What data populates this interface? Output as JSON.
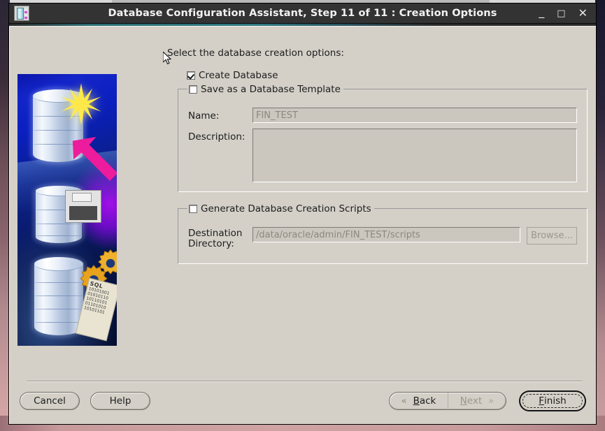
{
  "window": {
    "title": "Database Configuration Assistant, Step 11 of 11 : Creation Options",
    "icon_name": "database-app-icon",
    "minimize_label": "_",
    "maximize_label": "□",
    "close_label": "✕"
  },
  "main": {
    "intro_text": "Select the database creation options:",
    "create_database": {
      "label": "Create Database",
      "checked": true
    },
    "template_group": {
      "title": "Save as a Database Template",
      "checked": false,
      "name_label": "Name:",
      "name_value": "FIN_TEST",
      "description_label": "Description:",
      "description_value": ""
    },
    "scripts_group": {
      "title": "Generate Database Creation Scripts",
      "checked": false,
      "destination_label": "Destination Directory:",
      "destination_label_line1": "Destination",
      "destination_label_line2": "Directory:",
      "destination_value": "/data/oracle/admin/FIN_TEST/scripts",
      "browse_label": "Browse..."
    }
  },
  "illustration": {
    "name": "oracle-dbca-banner-image",
    "scroll_label": "SQL",
    "scroll_bits_1": "10101001",
    "scroll_bits_2": "01010110",
    "scroll_bits_3": "10110101",
    "scroll_bits_4": "01101010",
    "scroll_bits_5": "10101101"
  },
  "buttons": {
    "cancel": "Cancel",
    "help": "Help",
    "back": "Back",
    "back_mnemonic": "B",
    "back_rest": "ack",
    "next": "Next",
    "next_mnemonic": "N",
    "next_rest": "ext",
    "finish": "Finish",
    "finish_mnemonic": "F",
    "finish_rest": "inish",
    "back_chevron": "«",
    "next_chevron": "»"
  },
  "colors": {
    "titlebar_bg": "#333333",
    "window_bg": "#d4d0c8",
    "disabled_text": "#8b8880",
    "accent_magenta": "#ec1c9c",
    "accent_yellow": "#ffe94a"
  }
}
